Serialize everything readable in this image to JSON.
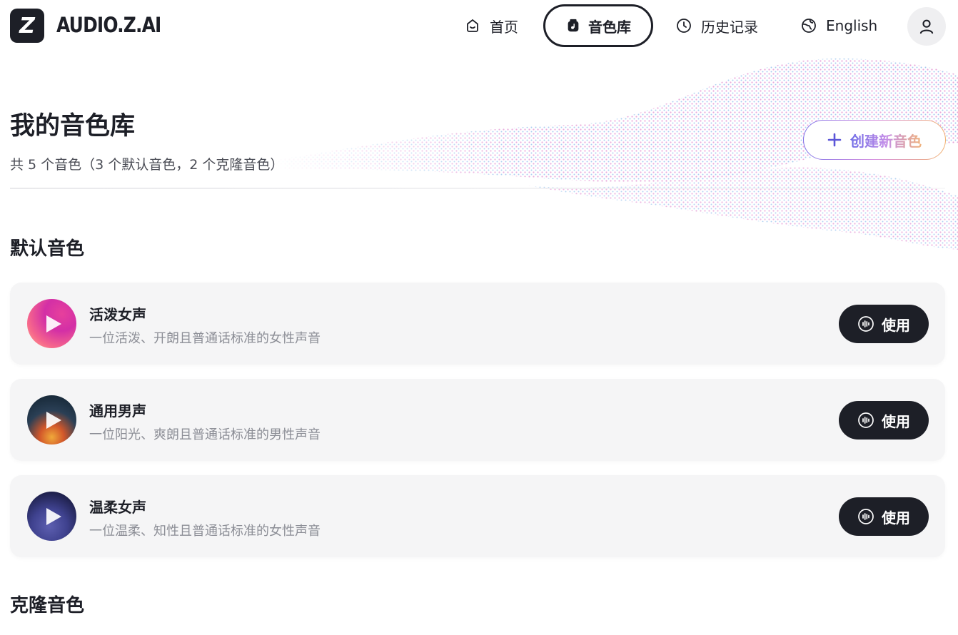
{
  "brand": {
    "name": "AUDIO.Z.AI",
    "logo_letter": "Z"
  },
  "nav": {
    "home": {
      "label": "首页",
      "icon": "home-icon"
    },
    "library": {
      "label": "音色库",
      "icon": "voice-library-icon",
      "active": true
    },
    "history": {
      "label": "历史记录",
      "icon": "clock-icon"
    },
    "language": {
      "label": "English",
      "icon": "globe-icon"
    },
    "account": {
      "icon": "user-icon"
    }
  },
  "page": {
    "title": "我的音色库",
    "summary": "共 5 个音色（3 个默认音色，2 个克隆音色）",
    "create_button": "创建新音色"
  },
  "sections": {
    "default_title": "默认音色",
    "cloned_title": "克隆音色"
  },
  "voices": [
    {
      "name": "活泼女声",
      "description": "一位活泼、开朗且普通话标准的女性声音",
      "use_label": "使用"
    },
    {
      "name": "通用男声",
      "description": "一位阳光、爽朗且普通话标准的男性声音",
      "use_label": "使用"
    },
    {
      "name": "温柔女声",
      "description": "一位温柔、知性且普通话标准的女性声音",
      "use_label": "使用"
    }
  ],
  "colors": {
    "primary_dark": "#1d1f27",
    "card_bg": "#f5f5f6",
    "muted_text": "#8c8e96",
    "gradient_start": "#7e72e8",
    "gradient_end": "#f1b070"
  }
}
